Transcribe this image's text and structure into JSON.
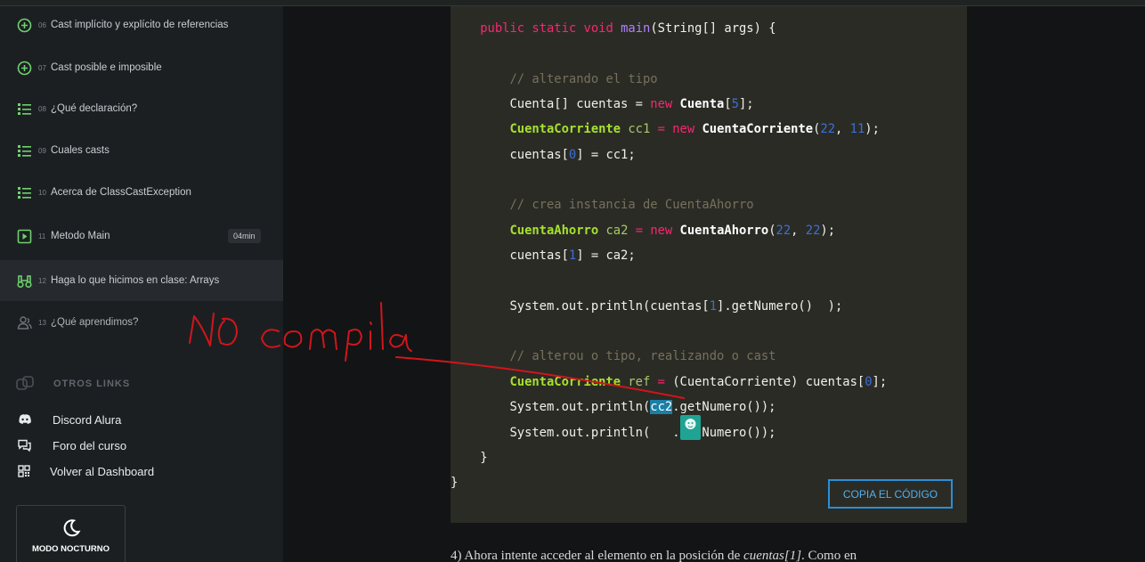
{
  "sidebar": {
    "lessons": [
      {
        "num": "06",
        "label": "Cast implícito y explícito de referencias",
        "icon": "plus-circle-icon"
      },
      {
        "num": "07",
        "label": "Cast posible e imposible",
        "icon": "plus-circle-icon"
      },
      {
        "num": "08",
        "label": "¿Qué declaración?",
        "icon": "list-icon"
      },
      {
        "num": "09",
        "label": "Cuales casts",
        "icon": "list-icon"
      },
      {
        "num": "10",
        "label": "Acerca de ClassCastException",
        "icon": "list-icon"
      },
      {
        "num": "11",
        "label": "Metodo Main",
        "icon": "play-icon",
        "duration": "04min"
      },
      {
        "num": "12",
        "label": "Haga lo que hicimos en clase: Arrays",
        "icon": "binoculars-icon"
      },
      {
        "num": "13",
        "label": "¿Qué aprendimos?",
        "icon": "people-icon"
      }
    ],
    "otros_links_title": "OTROS LINKS",
    "links": [
      {
        "label": "Discord Alura",
        "icon": "discord-icon"
      },
      {
        "label": "Foro del curso",
        "icon": "forum-icon"
      },
      {
        "label": "Volver al Dashboard",
        "icon": "dashboard-icon"
      }
    ],
    "night_mode_label": "MODO NOCTURNO"
  },
  "code": {
    "copy_label": "COPIA EL CÓDIGO"
  },
  "paragraph": {
    "text": "4) Ahora intente acceder al elemento en la posición de ",
    "em": "cuentas[1]",
    "tail": ". Como en"
  },
  "annotation": {
    "handwritten": "no compila",
    "color": "#d0161b"
  },
  "colors": {
    "accent_green": "#6fd16f",
    "copy_button_blue": "#2a8fd6"
  }
}
